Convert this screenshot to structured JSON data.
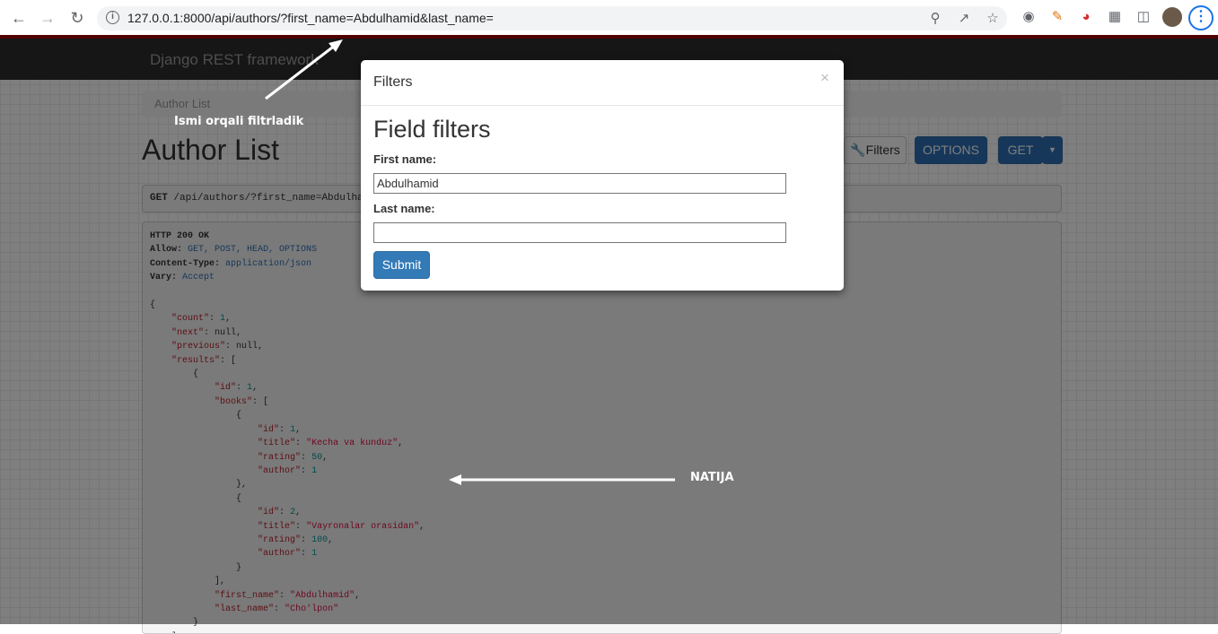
{
  "browser": {
    "url": "127.0.0.1:8000/api/authors/?first_name=Abdulhamid&last_name="
  },
  "navbar": {
    "brand": "Django REST framework"
  },
  "breadcrumb": {
    "item": "Author List"
  },
  "page": {
    "title": "Author List",
    "filters_button": "Filters",
    "options_button": "OPTIONS",
    "get_button": "GET",
    "request_method": "GET",
    "request_path": "/api/authors/?first_name=Abdulhamid&last_name="
  },
  "response": {
    "status": "HTTP 200 OK",
    "headers": [
      {
        "name": "Allow",
        "value": "GET, POST, HEAD, OPTIONS"
      },
      {
        "name": "Content-Type",
        "value": "application/json"
      },
      {
        "name": "Vary",
        "value": "Accept"
      }
    ],
    "count": 1,
    "next": "null",
    "previous": "null",
    "result": {
      "id": 1,
      "books": [
        {
          "id": 1,
          "title": "Kecha va kunduz",
          "rating": 50,
          "author": 1
        },
        {
          "id": 2,
          "title": "Vayronalar orasidan",
          "rating": 100,
          "author": 1
        }
      ],
      "first_name": "Abdulhamid",
      "last_name": "Cho‘lpon"
    }
  },
  "modal": {
    "title": "Filters",
    "close": "×",
    "heading": "Field filters",
    "first_name_label": "First name:",
    "first_name_value": "Abdulhamid",
    "last_name_label": "Last name:",
    "last_name_value": "",
    "submit_label": "Submit"
  },
  "annotations": {
    "top": "Ismi orqali filtrladik",
    "result": "NATIJA"
  }
}
